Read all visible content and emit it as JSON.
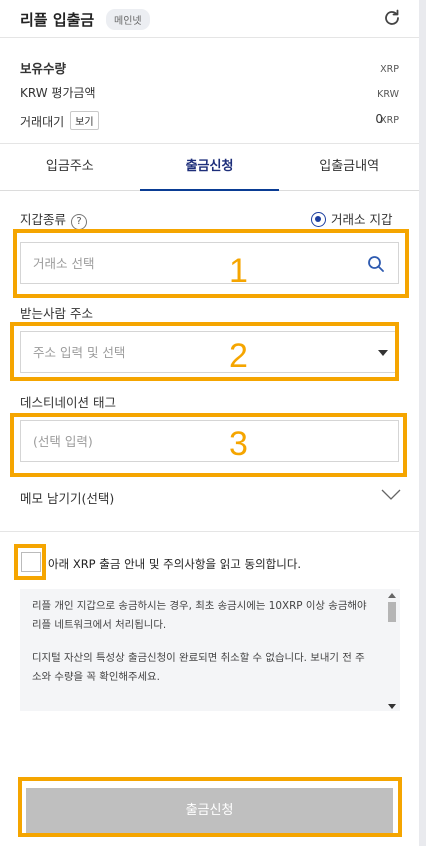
{
  "header": {
    "title": "리플 입출금",
    "network_badge": "메인넷",
    "refresh_icon": "refresh-icon"
  },
  "holdings": {
    "quantity_label": "보유수량",
    "quantity_unit": "XRP",
    "krw_label": "KRW 평가금액",
    "krw_unit": "KRW",
    "pending_label": "거래대기",
    "view_label": "보기",
    "pending_value": "0",
    "pending_unit": "XRP"
  },
  "tabs": [
    {
      "label": "입금주소",
      "active": false
    },
    {
      "label": "출금신청",
      "active": true
    },
    {
      "label": "입출금내역",
      "active": false
    }
  ],
  "form": {
    "wallet_type_label": "지갑종류",
    "help_icon": "?",
    "wallet_option_label": "거래소 지갑",
    "exchange_placeholder": "거래소 선택",
    "recipient_label": "받는사람 주소",
    "address_placeholder": "주소 입력 및 선택",
    "dest_tag_label": "데스티네이션 태그",
    "dest_tag_placeholder": "(선택 입력)",
    "memo_label": "메모 남기기(선택)"
  },
  "annotations": {
    "num1": "1",
    "num2": "2",
    "num3": "3",
    "color": "#f5a500"
  },
  "agreement": {
    "text": "아래 XRP 출금 안내 및 주의사항을 읽고 동의합니다.",
    "checked": false
  },
  "notice": {
    "paragraph1": "리플 개인 지갑으로 송금하시는 경우, 최초 송금시에는 10XRP 이상 송금해야 리플 네트워크에서 처리됩니다.",
    "paragraph2": "디지털 자산의 특성상 출금신청이 완료되면 취소할 수 없습니다. 보내기 전 주소와 수량을 꼭 확인해주세요."
  },
  "submit": {
    "label": "출금신청",
    "color": "#bfbfbf"
  },
  "colors": {
    "accent": "#0a3c94",
    "active_tab_text": "#1d2e7a"
  }
}
